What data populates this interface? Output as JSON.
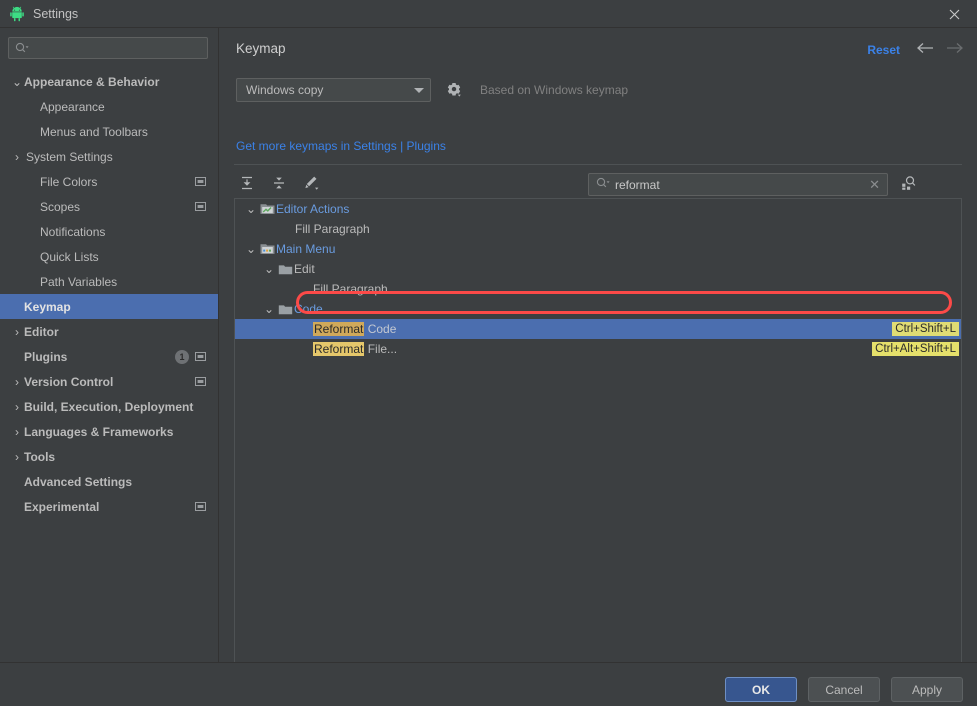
{
  "window": {
    "title": "Settings",
    "app_icon": "android-robot-icon",
    "close_label": "✕"
  },
  "sidebar": {
    "search": {
      "value": "",
      "placeholder": "",
      "icon": "search-dropdown-icon"
    },
    "items": [
      {
        "label": "Appearance & Behavior",
        "twisty": "⌄",
        "bold": true,
        "indent": 0,
        "selected": false,
        "indicator": "",
        "badge": ""
      },
      {
        "label": "Appearance",
        "twisty": "",
        "bold": false,
        "indent": 1,
        "selected": false,
        "indicator": "",
        "badge": ""
      },
      {
        "label": "Menus and Toolbars",
        "twisty": "",
        "bold": false,
        "indent": 1,
        "selected": false,
        "indicator": "",
        "badge": ""
      },
      {
        "label": "System Settings",
        "twisty": "›",
        "bold": false,
        "indent": 1,
        "selected": false,
        "indicator": "",
        "badge": ""
      },
      {
        "label": "File Colors",
        "twisty": "",
        "bold": false,
        "indent": 1,
        "selected": false,
        "indicator": "project-scope-icon",
        "badge": ""
      },
      {
        "label": "Scopes",
        "twisty": "",
        "bold": false,
        "indent": 1,
        "selected": false,
        "indicator": "project-scope-icon",
        "badge": ""
      },
      {
        "label": "Notifications",
        "twisty": "",
        "bold": false,
        "indent": 1,
        "selected": false,
        "indicator": "",
        "badge": ""
      },
      {
        "label": "Quick Lists",
        "twisty": "",
        "bold": false,
        "indent": 1,
        "selected": false,
        "indicator": "",
        "badge": ""
      },
      {
        "label": "Path Variables",
        "twisty": "",
        "bold": false,
        "indent": 1,
        "selected": false,
        "indicator": "",
        "badge": ""
      },
      {
        "label": "Keymap",
        "twisty": "",
        "bold": true,
        "indent": 0,
        "selected": true,
        "indicator": "",
        "badge": ""
      },
      {
        "label": "Editor",
        "twisty": "›",
        "bold": true,
        "indent": 0,
        "selected": false,
        "indicator": "",
        "badge": ""
      },
      {
        "label": "Plugins",
        "twisty": "",
        "bold": true,
        "indent": 0,
        "selected": false,
        "indicator": "project-scope-icon",
        "badge": "1"
      },
      {
        "label": "Version Control",
        "twisty": "›",
        "bold": true,
        "indent": 0,
        "selected": false,
        "indicator": "project-scope-icon",
        "badge": ""
      },
      {
        "label": "Build, Execution, Deployment",
        "twisty": "›",
        "bold": true,
        "indent": 0,
        "selected": false,
        "indicator": "",
        "badge": ""
      },
      {
        "label": "Languages & Frameworks",
        "twisty": "›",
        "bold": true,
        "indent": 0,
        "selected": false,
        "indicator": "",
        "badge": ""
      },
      {
        "label": "Tools",
        "twisty": "›",
        "bold": true,
        "indent": 0,
        "selected": false,
        "indicator": "",
        "badge": ""
      },
      {
        "label": "Advanced Settings",
        "twisty": "",
        "bold": true,
        "indent": 0,
        "selected": false,
        "indicator": "",
        "badge": ""
      },
      {
        "label": "Experimental",
        "twisty": "",
        "bold": true,
        "indent": 0,
        "selected": false,
        "indicator": "project-scope-icon",
        "badge": ""
      }
    ],
    "help_label": "?"
  },
  "main": {
    "page_title": "Keymap",
    "reset_label": "Reset",
    "back_icon": "arrow-left-icon",
    "forward_icon": "arrow-right-icon",
    "keymap_select": {
      "value": "Windows copy",
      "caret": "▼"
    },
    "gear_icon": "gear-icon",
    "based_on": "Based on Windows keymap",
    "get_more_link": "Get more keymaps in Settings | Plugins",
    "toolbar": [
      {
        "icon": "expand-all-icon"
      },
      {
        "icon": "collapse-all-icon"
      },
      {
        "icon": "edit-shortcut-icon"
      }
    ],
    "search": {
      "value": "reformat",
      "placeholder": "",
      "icon": "search-dropdown-icon",
      "clear_icon": "✕"
    },
    "find_by_shortcut_icon": "find-by-shortcut-icon",
    "tree": [
      {
        "indent": 0,
        "twisty": "⌄",
        "icon": "editor-actions-icon",
        "pre": "",
        "text": "Editor Actions",
        "blue": true,
        "shortcut": "",
        "selected": false
      },
      {
        "indent": 2,
        "twisty": "",
        "icon": "",
        "pre": "",
        "text": "Fill Paragraph",
        "blue": false,
        "shortcut": "",
        "selected": false
      },
      {
        "indent": 0,
        "twisty": "⌄",
        "icon": "main-menu-icon",
        "pre": "",
        "text": "Main Menu",
        "blue": true,
        "shortcut": "",
        "selected": false
      },
      {
        "indent": 1,
        "twisty": "⌄",
        "icon": "folder-icon",
        "pre": "",
        "text": "Edit",
        "blue": false,
        "shortcut": "",
        "selected": false
      },
      {
        "indent": 3,
        "twisty": "",
        "icon": "",
        "pre": "",
        "text": "Fill Paragraph",
        "blue": false,
        "shortcut": "",
        "selected": false
      },
      {
        "indent": 1,
        "twisty": "⌄",
        "icon": "folder-icon",
        "pre": "",
        "text": "Code",
        "blue": true,
        "shortcut": "",
        "selected": false
      },
      {
        "indent": 3,
        "twisty": "",
        "icon": "",
        "pre": "Reformat",
        "text": " Code",
        "blue": false,
        "shortcut": "Ctrl+Shift+L",
        "selected": true
      },
      {
        "indent": 3,
        "twisty": "",
        "icon": "",
        "pre": "Reformat",
        "text": " File...",
        "blue": false,
        "shortcut": "Ctrl+Alt+Shift+L",
        "selected": false
      }
    ]
  },
  "footer": {
    "ok_label": "OK",
    "cancel_label": "Cancel",
    "apply_label": "Apply"
  },
  "colors": {
    "selection_blue": "#4b6eaf",
    "link_blue": "#3b82e8",
    "tree_blue": "#6a9ce0",
    "highlight_yellow": "#e5c76b",
    "shortcut_yellow": "#e5e06b",
    "annotation_red": "#fc4a48",
    "background": "#3c3f41",
    "android_green": "#3ddc84"
  }
}
